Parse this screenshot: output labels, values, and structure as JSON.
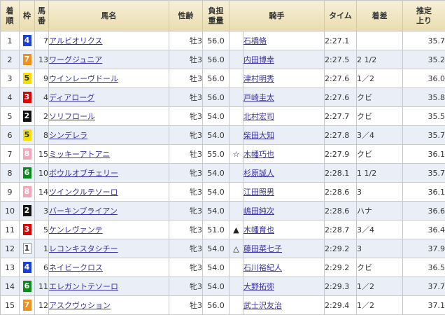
{
  "headers": {
    "rank": "着順",
    "frame": "枠",
    "horse_no": "馬番",
    "horse_name": "馬名",
    "sex_age": "性齢",
    "weight": "負担重量",
    "jockey": "騎手",
    "time": "タイム",
    "margin": "着差",
    "last3f": "推定上り"
  },
  "frame_colors": {
    "1": "#ffffff",
    "2": "#111111",
    "3": "#e00000",
    "4": "#1c3fd8",
    "5": "#f5e000",
    "6": "#0a8a1a",
    "7": "#f0901a",
    "8": "#f4a5b8"
  },
  "rows": [
    {
      "rank": "1",
      "frame": "4",
      "horse_no": "7",
      "horse": "アルビオリクス",
      "sex_age": "牡3",
      "weight": "56.0",
      "mark": "",
      "jockey": "石橋脩",
      "time": "2:27.1",
      "margin": "",
      "last3f": "35.7"
    },
    {
      "rank": "2",
      "frame": "7",
      "horse_no": "13",
      "horse": "ワーグジュニア",
      "sex_age": "牡3",
      "weight": "56.0",
      "mark": "",
      "jockey": "内田博幸",
      "time": "2:27.5",
      "margin": "2 1/2",
      "last3f": "35.2"
    },
    {
      "rank": "3",
      "frame": "5",
      "horse_no": "9",
      "horse": "ウインレーヴドール",
      "sex_age": "牡3",
      "weight": "56.0",
      "mark": "",
      "jockey": "津村明秀",
      "time": "2:27.6",
      "margin": "1／2",
      "last3f": "36.0"
    },
    {
      "rank": "4",
      "frame": "3",
      "horse_no": "4",
      "horse": "ディアローグ",
      "sex_age": "牡3",
      "weight": "56.0",
      "mark": "",
      "jockey": "戸崎圭太",
      "time": "2:27.6",
      "margin": "クビ",
      "last3f": "35.8"
    },
    {
      "rank": "5",
      "frame": "2",
      "horse_no": "2",
      "horse": "ソリフロール",
      "sex_age": "牝3",
      "weight": "54.0",
      "mark": "",
      "jockey": "北村宏司",
      "time": "2:27.7",
      "margin": "クビ",
      "last3f": "35.5"
    },
    {
      "rank": "6",
      "frame": "5",
      "horse_no": "8",
      "horse": "シンデレラ",
      "sex_age": "牝3",
      "weight": "54.0",
      "mark": "",
      "jockey": "柴田大知",
      "time": "2:27.8",
      "margin": "3／4",
      "last3f": "35.7"
    },
    {
      "rank": "7",
      "frame": "8",
      "horse_no": "15",
      "horse": "ミッキーアトアニ",
      "sex_age": "牡3",
      "weight": "55.0",
      "mark": "☆",
      "jockey": "木幡巧也",
      "time": "2:27.9",
      "margin": "クビ",
      "last3f": "36.1"
    },
    {
      "rank": "8",
      "frame": "6",
      "horse_no": "10",
      "horse": "ボウルオブチェリー",
      "sex_age": "牝3",
      "weight": "54.0",
      "mark": "",
      "jockey": "杉原誠人",
      "time": "2:28.1",
      "margin": "1 1/2",
      "last3f": "35.7"
    },
    {
      "rank": "9",
      "frame": "8",
      "horse_no": "14",
      "horse": "ツインクルテソーロ",
      "sex_age": "牝3",
      "weight": "54.0",
      "mark": "",
      "jockey": "江田照男",
      "time": "2:28.6",
      "margin": "3",
      "last3f": "36.1"
    },
    {
      "rank": "10",
      "frame": "2",
      "horse_no": "3",
      "horse": "バーキンブライアン",
      "sex_age": "牝3",
      "weight": "54.0",
      "mark": "",
      "jockey": "嶋田純次",
      "time": "2:28.6",
      "margin": "ハナ",
      "last3f": "36.6"
    },
    {
      "rank": "11",
      "frame": "3",
      "horse_no": "5",
      "horse": "ケンレヴァンテ",
      "sex_age": "牝3",
      "weight": "51.0",
      "mark": "▲",
      "jockey": "木幡育也",
      "time": "2:28.7",
      "margin": "3／4",
      "last3f": "36.4"
    },
    {
      "rank": "12",
      "frame": "1",
      "horse_no": "1",
      "horse": "レコンキスタシチー",
      "sex_age": "牝3",
      "weight": "54.0",
      "mark": "△",
      "jockey": "藤田菜七子",
      "time": "2:29.2",
      "margin": "3",
      "last3f": "37.9"
    },
    {
      "rank": "13",
      "frame": "4",
      "horse_no": "6",
      "horse": "ネイビークロス",
      "sex_age": "牝3",
      "weight": "54.0",
      "mark": "",
      "jockey": "石川裕紀人",
      "time": "2:29.2",
      "margin": "クビ",
      "last3f": "36.5"
    },
    {
      "rank": "14",
      "frame": "6",
      "horse_no": "11",
      "horse": "エレガントテソーロ",
      "sex_age": "牝3",
      "weight": "54.0",
      "mark": "",
      "jockey": "大野拓弥",
      "time": "2:29.3",
      "margin": "1／2",
      "last3f": "37.7"
    },
    {
      "rank": "15",
      "frame": "7",
      "horse_no": "12",
      "horse": "アスクヴゥション",
      "sex_age": "牡3",
      "weight": "56.0",
      "mark": "",
      "jockey": "武士沢友治",
      "time": "2:29.4",
      "margin": "1／2",
      "last3f": "37.1"
    }
  ]
}
